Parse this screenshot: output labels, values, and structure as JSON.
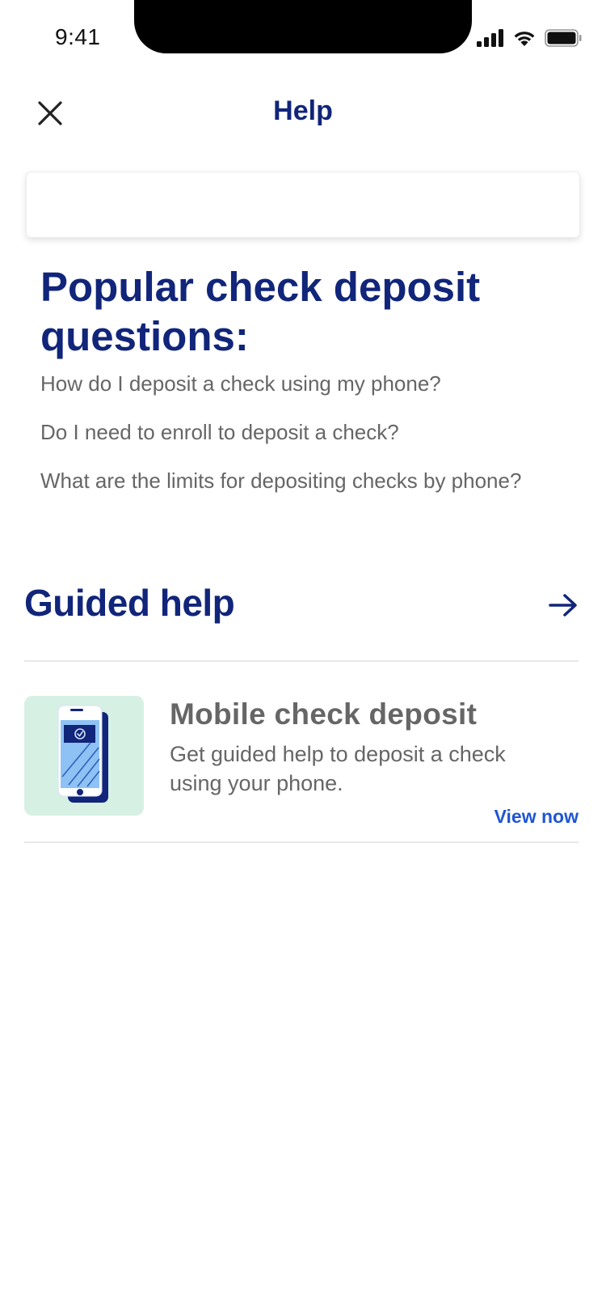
{
  "status_bar": {
    "time": "9:41"
  },
  "header": {
    "title": "Help",
    "close_icon": "close-icon"
  },
  "search": {
    "value": "",
    "placeholder": ""
  },
  "popular": {
    "title": "Popular check deposit questions:",
    "questions": [
      "How do I deposit a check using my phone?",
      "Do I need to enroll to deposit a check?",
      "What are the limits for depositing checks by phone?"
    ]
  },
  "guided_help": {
    "title": "Guided help",
    "arrow_icon": "arrow-right-icon",
    "card": {
      "image_icon": "phone-check-icon",
      "title": "Mobile check deposit",
      "description": "Get guided help to deposit a check using your phone.",
      "link_label": "View now"
    }
  },
  "colors": {
    "brand_navy": "#11257a",
    "link_blue": "#1f55d4",
    "muted_text": "#666666",
    "card_bg": "#d6f1e4"
  }
}
